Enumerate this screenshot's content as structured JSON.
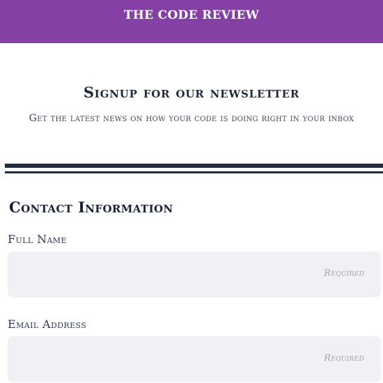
{
  "header": {
    "title": "THE CODE REVIEW",
    "background_color": "#8540a6"
  },
  "signup": {
    "title": "Signup for our newsletter",
    "subtitle": "Get the latest news on how your code is doing right in your inbox"
  },
  "contact": {
    "title": "Contact Information",
    "fields": [
      {
        "label": "Full Name",
        "value": "",
        "hint": "Required"
      },
      {
        "label": "Email Address",
        "value": "",
        "hint": "Required"
      }
    ]
  }
}
